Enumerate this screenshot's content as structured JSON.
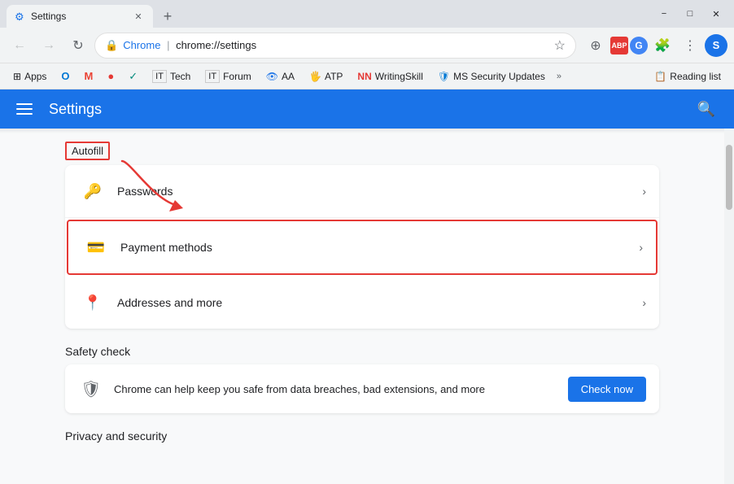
{
  "titlebar": {
    "tab_title": "Settings",
    "favicon": "⚙",
    "new_tab_icon": "+",
    "minimize": "−",
    "maximize": "□",
    "close": "✕"
  },
  "navbar": {
    "back_icon": "←",
    "forward_icon": "→",
    "refresh_icon": "↻",
    "address_chrome": "Chrome",
    "address_url": "chrome://settings",
    "divider": "|",
    "star_icon": "☆",
    "profile_letter": "S"
  },
  "bookmarks": {
    "apps_label": "Apps",
    "items": [
      {
        "label": "M",
        "color": "#ea4335"
      },
      {
        "label": "●",
        "color": "#e53935"
      },
      {
        "label": "✓",
        "color": "#00897b"
      },
      {
        "label": "T",
        "color": "#455a64"
      },
      {
        "label": "Forum",
        "color": "#455a64"
      },
      {
        "label": "AA",
        "color": "#1a73e8"
      },
      {
        "label": "ATP",
        "color": "#2e7d32"
      },
      {
        "label": "NN WritingSkill",
        "color": "#202124"
      },
      {
        "label": "MS Security Updates",
        "color": "#202124"
      }
    ],
    "more": "»",
    "reading_list": "Reading list"
  },
  "settings_header": {
    "title": "Settings",
    "search_icon": "🔍"
  },
  "autofill": {
    "label": "Autofill",
    "items": [
      {
        "icon": "🔑",
        "label": "Passwords",
        "chevron": "›"
      },
      {
        "icon": "💳",
        "label": "Payment methods",
        "chevron": "›",
        "highlighted": true
      },
      {
        "icon": "📍",
        "label": "Addresses and more",
        "chevron": "›"
      }
    ]
  },
  "safety_check": {
    "heading": "Safety check",
    "description": "Chrome can help keep you safe from data breaches, bad extensions, and more",
    "button_label": "Check now",
    "shield_icon": "🛡"
  },
  "privacy": {
    "heading": "Privacy and security"
  },
  "annotation": {
    "autofill_label": "Autofill",
    "arrow_target": "Payment methods"
  }
}
